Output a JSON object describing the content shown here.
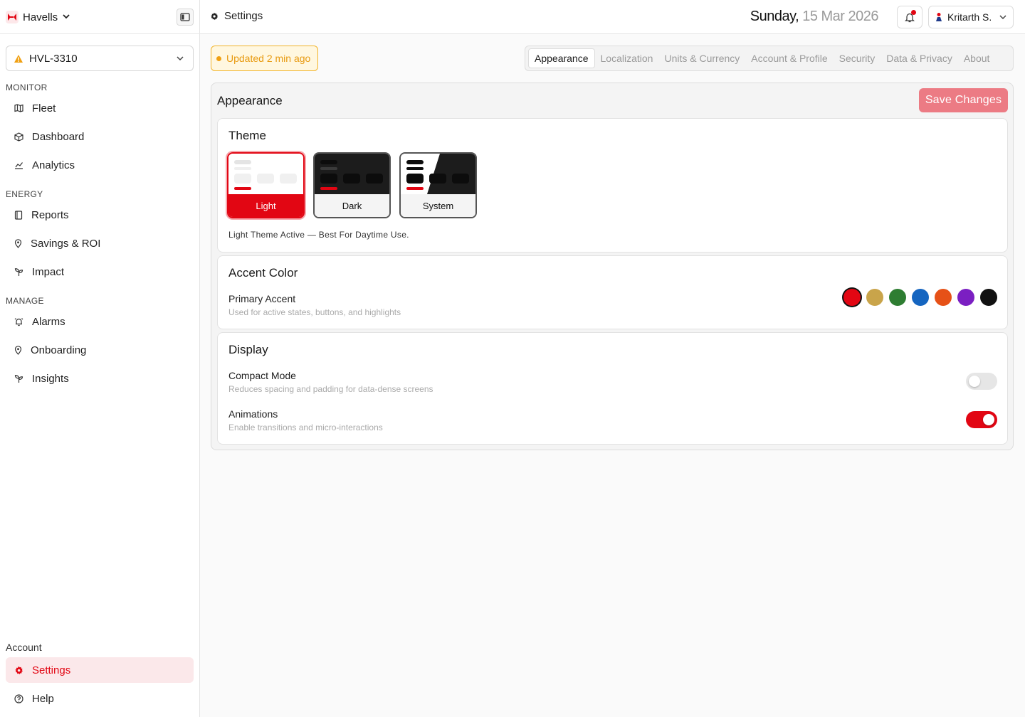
{
  "brand": {
    "name": "Havells"
  },
  "site": {
    "value": "HVL-3310"
  },
  "sidebar": {
    "sections": [
      {
        "label": "MONITOR",
        "items": [
          {
            "label": "Fleet",
            "icon": "map-icon"
          },
          {
            "label": "Dashboard",
            "icon": "cube-icon"
          },
          {
            "label": "Analytics",
            "icon": "chart-icon"
          }
        ]
      },
      {
        "label": "ENERGY",
        "items": [
          {
            "label": "Reports",
            "icon": "book-icon"
          },
          {
            "label": "Savings & ROI",
            "icon": "pin-icon"
          },
          {
            "label": "Impact",
            "icon": "sprout-icon"
          }
        ]
      },
      {
        "label": "MANAGE",
        "items": [
          {
            "label": "Alarms",
            "icon": "alarm-icon"
          },
          {
            "label": "Onboarding",
            "icon": "pin-icon"
          },
          {
            "label": "Insights",
            "icon": "sprout-icon"
          }
        ]
      }
    ],
    "account_label": "Account",
    "account_items": [
      {
        "label": "Settings",
        "icon": "gear-icon",
        "active": true
      },
      {
        "label": "Help",
        "icon": "help-icon"
      }
    ]
  },
  "topbar": {
    "breadcrumb": "Settings",
    "date_day": "Sunday,",
    "date_rest": " 15 Mar 2026",
    "user_name": "Kritarth S."
  },
  "status": {
    "updated": "Updated 2 min ago"
  },
  "tabs": [
    {
      "label": "Appearance",
      "active": true
    },
    {
      "label": "Localization"
    },
    {
      "label": "Units & Currency"
    },
    {
      "label": "Account & Profile"
    },
    {
      "label": "Security"
    },
    {
      "label": "Data & Privacy"
    },
    {
      "label": "About"
    }
  ],
  "panel": {
    "title": "Appearance",
    "save_label": "Save Changes"
  },
  "theme": {
    "title": "Theme",
    "options": [
      {
        "label": "Light",
        "selected": true
      },
      {
        "label": "Dark"
      },
      {
        "label": "System"
      }
    ],
    "description": "Light Theme Active — Best For Daytime Use."
  },
  "accent": {
    "title": "Accent Color",
    "primary_label": "Primary Accent",
    "primary_sub": "Used for active states, buttons, and highlights",
    "colors": [
      "#e20613",
      "#c9a44a",
      "#2e7d32",
      "#1565c0",
      "#e65117",
      "#7b1fc2",
      "#111111"
    ],
    "selected_color": "#e20613"
  },
  "display": {
    "title": "Display",
    "compact_label": "Compact Mode",
    "compact_sub": "Reduces spacing and padding for data-dense screens",
    "compact_on": false,
    "anim_label": "Animations",
    "anim_sub": "Enable transitions and micro-interactions",
    "anim_on": true
  },
  "colors": {
    "brand_red": "#e20613",
    "warning": "#f0a012"
  }
}
